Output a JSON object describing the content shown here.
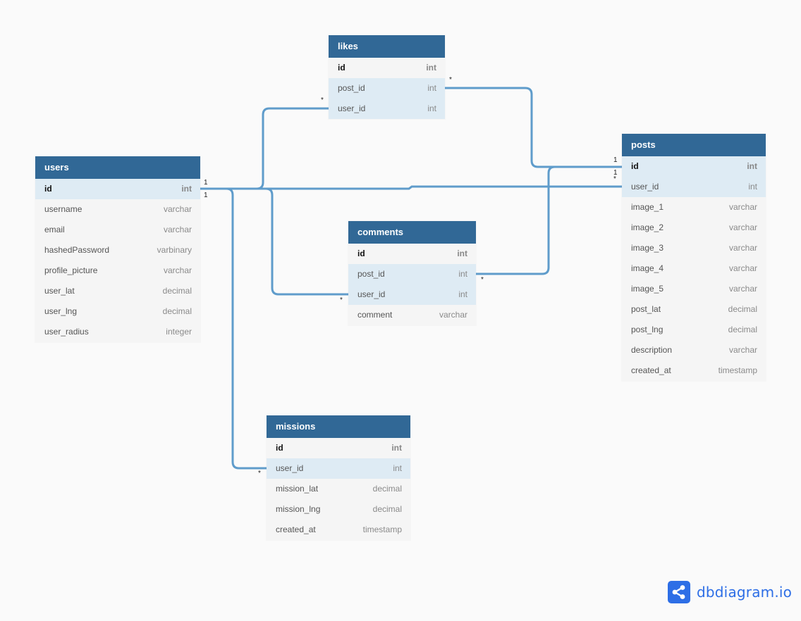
{
  "tables": {
    "likes": {
      "name": "likes",
      "fields": [
        {
          "name": "id",
          "type": "int",
          "pk": true,
          "highlight": false
        },
        {
          "name": "post_id",
          "type": "int",
          "pk": false,
          "highlight": true
        },
        {
          "name": "user_id",
          "type": "int",
          "pk": false,
          "highlight": true
        }
      ]
    },
    "users": {
      "name": "users",
      "fields": [
        {
          "name": "id",
          "type": "int",
          "pk": true,
          "highlight": true
        },
        {
          "name": "username",
          "type": "varchar",
          "pk": false,
          "highlight": false
        },
        {
          "name": "email",
          "type": "varchar",
          "pk": false,
          "highlight": false
        },
        {
          "name": "hashedPassword",
          "type": "varbinary",
          "pk": false,
          "highlight": false
        },
        {
          "name": "profile_picture",
          "type": "varchar",
          "pk": false,
          "highlight": false
        },
        {
          "name": "user_lat",
          "type": "decimal",
          "pk": false,
          "highlight": false
        },
        {
          "name": "user_lng",
          "type": "decimal",
          "pk": false,
          "highlight": false
        },
        {
          "name": "user_radius",
          "type": "integer",
          "pk": false,
          "highlight": false
        }
      ]
    },
    "comments": {
      "name": "comments",
      "fields": [
        {
          "name": "id",
          "type": "int",
          "pk": true,
          "highlight": false
        },
        {
          "name": "post_id",
          "type": "int",
          "pk": false,
          "highlight": true
        },
        {
          "name": "user_id",
          "type": "int",
          "pk": false,
          "highlight": true
        },
        {
          "name": "comment",
          "type": "varchar",
          "pk": false,
          "highlight": false
        }
      ]
    },
    "posts": {
      "name": "posts",
      "fields": [
        {
          "name": "id",
          "type": "int",
          "pk": true,
          "highlight": true
        },
        {
          "name": "user_id",
          "type": "int",
          "pk": false,
          "highlight": true
        },
        {
          "name": "image_1",
          "type": "varchar",
          "pk": false,
          "highlight": false
        },
        {
          "name": "image_2",
          "type": "varchar",
          "pk": false,
          "highlight": false
        },
        {
          "name": "image_3",
          "type": "varchar",
          "pk": false,
          "highlight": false
        },
        {
          "name": "image_4",
          "type": "varchar",
          "pk": false,
          "highlight": false
        },
        {
          "name": "image_5",
          "type": "varchar",
          "pk": false,
          "highlight": false
        },
        {
          "name": "post_lat",
          "type": "decimal",
          "pk": false,
          "highlight": false
        },
        {
          "name": "post_lng",
          "type": "decimal",
          "pk": false,
          "highlight": false
        },
        {
          "name": "description",
          "type": "varchar",
          "pk": false,
          "highlight": false
        },
        {
          "name": "created_at",
          "type": "timestamp",
          "pk": false,
          "highlight": false
        }
      ]
    },
    "missions": {
      "name": "missions",
      "fields": [
        {
          "name": "id",
          "type": "int",
          "pk": true,
          "highlight": false
        },
        {
          "name": "user_id",
          "type": "int",
          "pk": false,
          "highlight": true
        },
        {
          "name": "mission_lat",
          "type": "decimal",
          "pk": false,
          "highlight": false
        },
        {
          "name": "mission_lng",
          "type": "decimal",
          "pk": false,
          "highlight": false
        },
        {
          "name": "created_at",
          "type": "timestamp",
          "pk": false,
          "highlight": false
        }
      ]
    }
  },
  "relationships": [
    {
      "from": "likes.user_id",
      "to": "users.id",
      "from_card": "*",
      "to_card": "1"
    },
    {
      "from": "likes.post_id",
      "to": "posts.id",
      "from_card": "*",
      "to_card": "1"
    },
    {
      "from": "comments.user_id",
      "to": "users.id",
      "from_card": "*",
      "to_card": "1"
    },
    {
      "from": "comments.post_id",
      "to": "posts.id",
      "from_card": "*",
      "to_card": "1"
    },
    {
      "from": "posts.user_id",
      "to": "users.id",
      "from_card": "*",
      "to_card": "1"
    },
    {
      "from": "missions.user_id",
      "to": "users.id",
      "from_card": "*",
      "to_card": "1"
    }
  ],
  "cardinality": {
    "one": "1",
    "many": "*"
  },
  "colors": {
    "header": "#316896",
    "link": "#5f9ccb",
    "highlight": "#deebf4",
    "brand": "#2d6ee6"
  },
  "brand": {
    "name": "dbdiagram.io",
    "icon": "share-icon"
  }
}
